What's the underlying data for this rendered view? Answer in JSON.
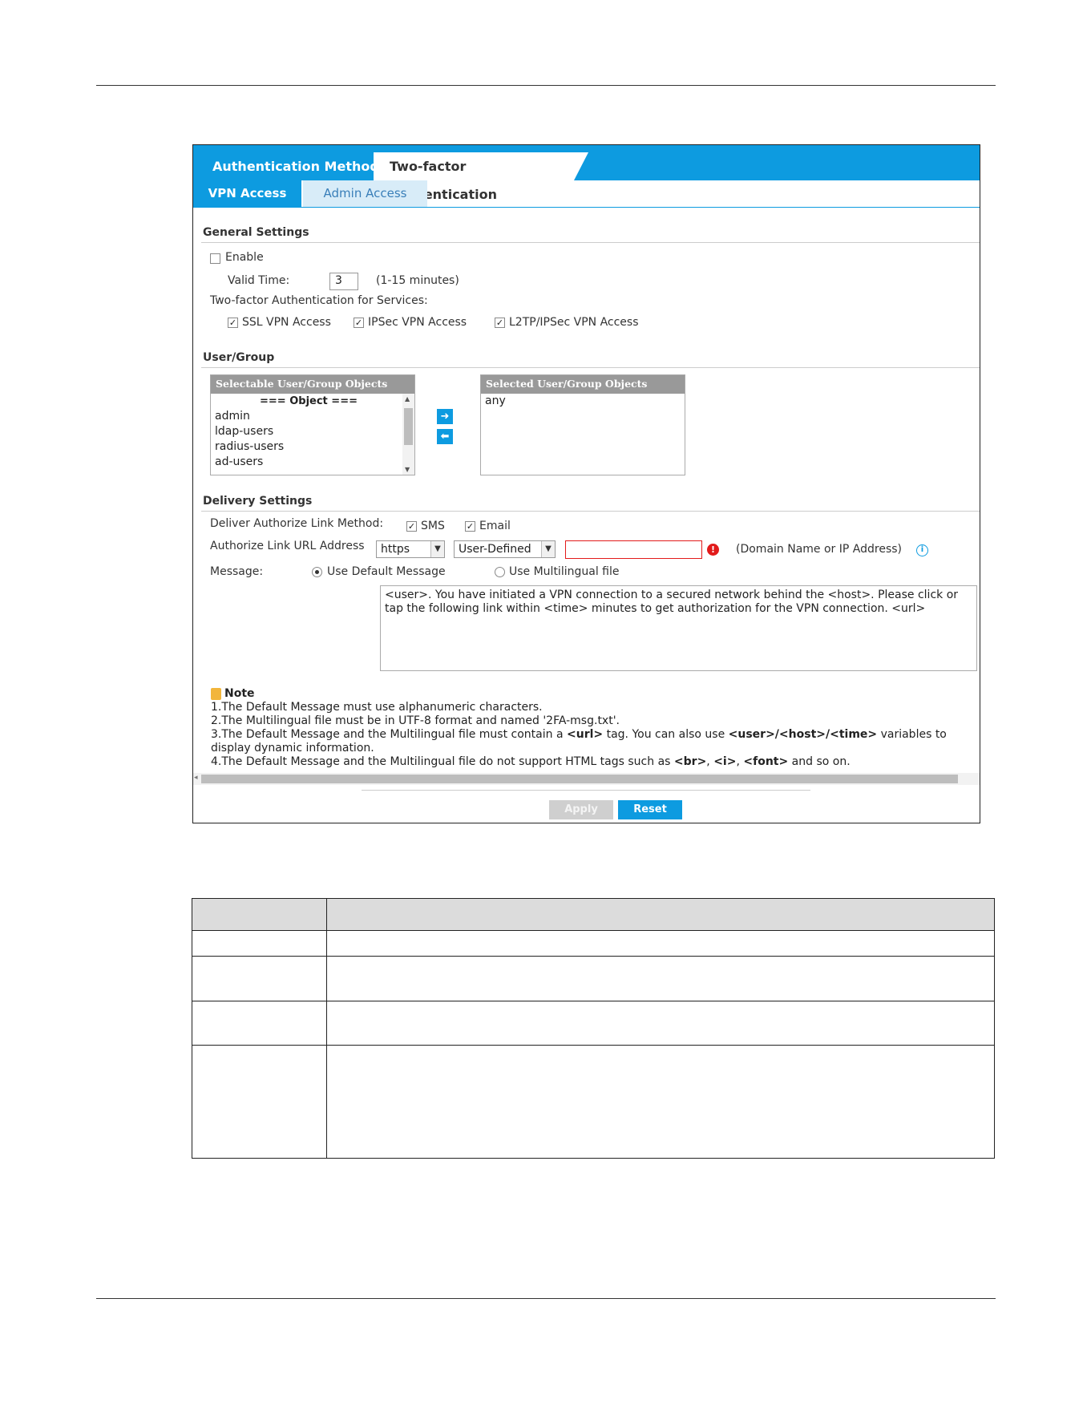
{
  "tabs": {
    "main": [
      "Authentication Method",
      "Two-factor Authentication"
    ],
    "sub": [
      "VPN Access",
      "Admin Access"
    ]
  },
  "general": {
    "title": "General Settings",
    "enable_label": "Enable",
    "valid_time_label": "Valid Time:",
    "valid_time_value": "3",
    "valid_time_hint": "(1-15 minutes)",
    "services_label": "Two-factor Authentication for Services:",
    "services": [
      {
        "label": "SSL VPN Access",
        "checked": true
      },
      {
        "label": "IPSec VPN Access",
        "checked": true
      },
      {
        "label": "L2TP/IPSec VPN Access",
        "checked": true
      }
    ]
  },
  "user_group": {
    "title": "User/Group",
    "selectable_header": "Selectable User/Group Objects",
    "selectable_items": [
      "=== Object ===",
      "admin",
      "ldap-users",
      "radius-users",
      "ad-users"
    ],
    "selected_header": "Selected User/Group Objects",
    "selected_items": [
      "any"
    ]
  },
  "delivery": {
    "title": "Delivery Settings",
    "method_label": "Deliver Authorize Link Method:",
    "sms_label": "SMS",
    "email_label": "Email",
    "url_label": "Authorize Link URL Address",
    "protocol": "https",
    "address_type": "User-Defined",
    "address_value": "",
    "address_hint": "(Domain Name or IP Address)",
    "message_label": "Message:",
    "default_msg_label": "Use Default Message",
    "multilingual_label": "Use Multilingual file",
    "message_text": "<user>. You have initiated a VPN connection to a secured network behind the <host>. Please click or tap the following link within <time> minutes to get authorization for the VPN connection. <url>"
  },
  "notes": {
    "title": "Note",
    "n1": "1.The Default Message must use alphanumeric characters.",
    "n2": "2.The Multilingual file must be in UTF-8 format and named '2FA-msg.txt'.",
    "n3a": "3.The Default Message and the Multilingual file must contain a ",
    "n3b": "<url>",
    "n3c": " tag. You can also use ",
    "n3d": "<user>/<host>/<time>",
    "n3e": " variables to display dynamic information.",
    "n4a": "4.The Default Message and the Multilingual file do not support HTML tags such as ",
    "n4b": "<br>",
    "n4c": ", ",
    "n4d": "<i>",
    "n4e": ", ",
    "n4f": "<font>",
    "n4g": " and so on."
  },
  "buttons": {
    "apply": "Apply",
    "reset": "Reset"
  },
  "colors": {
    "accent": "#0d9be0",
    "error": "#e21b1b"
  },
  "icons": [
    "arrow-right-icon",
    "arrow-left-icon",
    "error-icon",
    "info-icon",
    "note-icon"
  ]
}
